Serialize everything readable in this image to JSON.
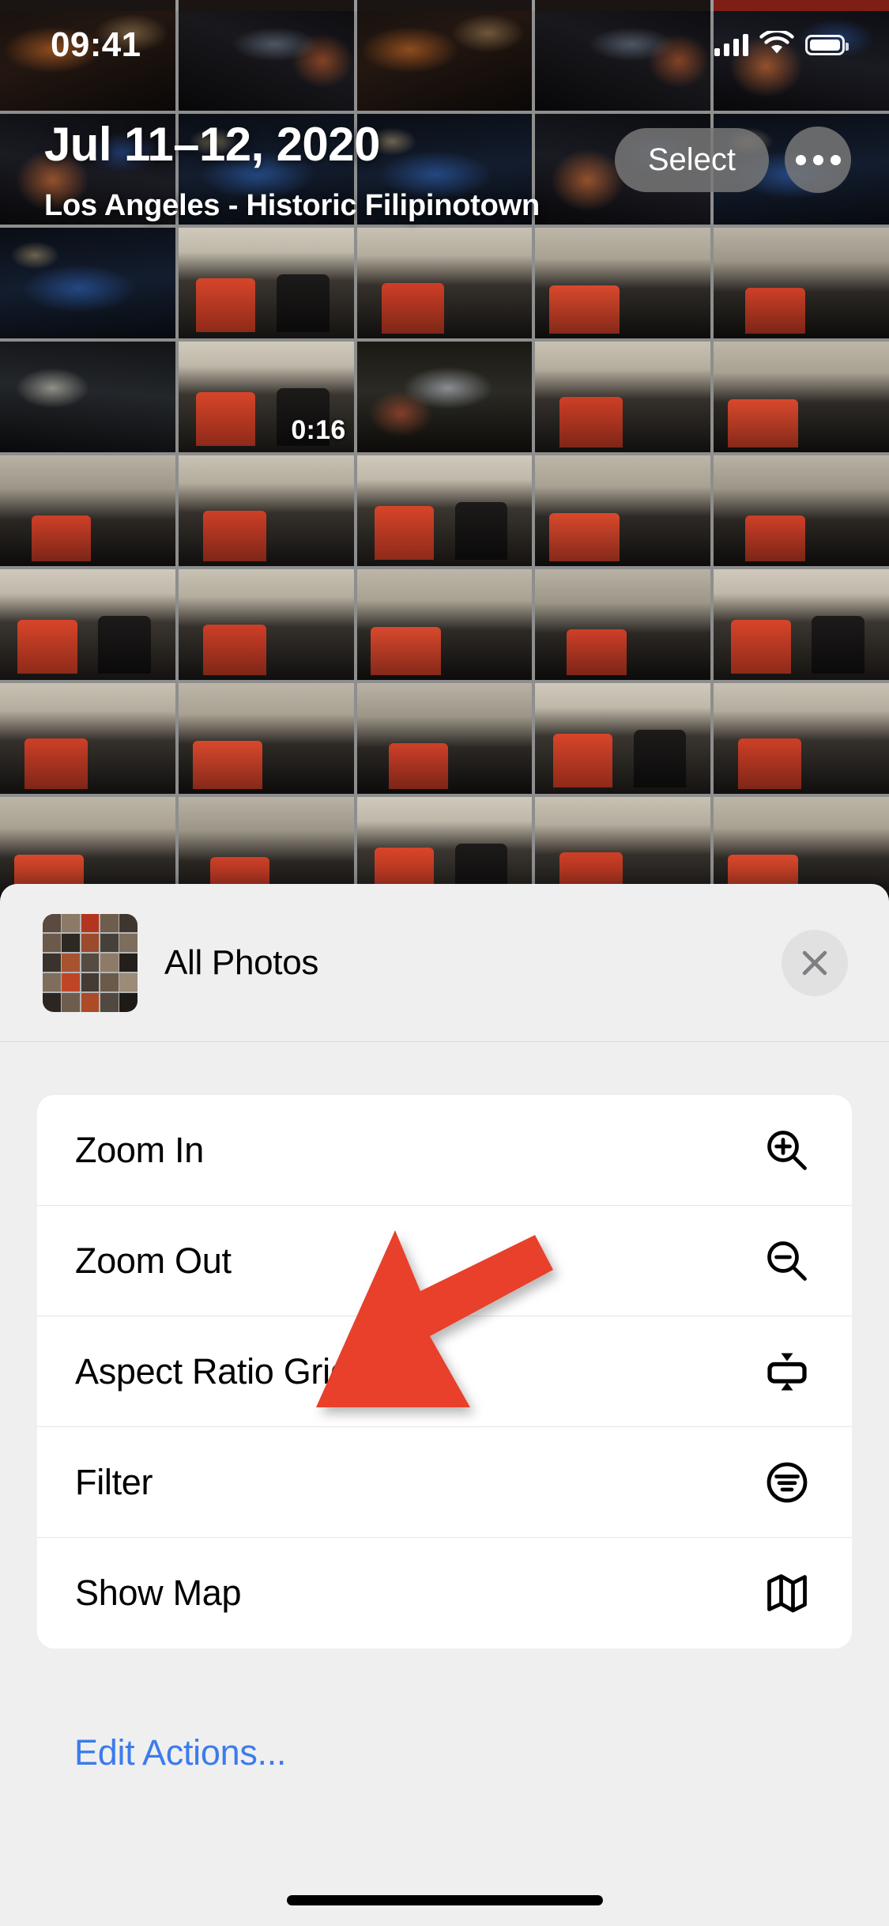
{
  "status_bar": {
    "time": "09:41",
    "signal_icon": "cellular-signal-icon",
    "wifi_icon": "wifi-icon",
    "battery_icon": "battery-full-icon"
  },
  "photos_header": {
    "title": "Jul 11–12, 2020",
    "subtitle": "Los Angeles - Historic Filipinotown",
    "select_label": "Select",
    "more_icon": "ellipsis-icon"
  },
  "photo_grid": {
    "columns": 5,
    "video_badge": "0:16"
  },
  "sheet": {
    "app_name": "All Photos",
    "close_icon": "close-x-icon",
    "menu_items": [
      {
        "label": "Zoom In",
        "icon": "magnifier-plus-icon"
      },
      {
        "label": "Zoom Out",
        "icon": "magnifier-minus-icon"
      },
      {
        "label": "Aspect Ratio Grid",
        "icon": "aspect-ratio-grid-icon"
      },
      {
        "label": "Filter",
        "icon": "filter-circle-icon"
      },
      {
        "label": "Show Map",
        "icon": "map-icon"
      }
    ],
    "edit_actions_label": "Edit Actions..."
  },
  "annotation": {
    "arrow_color": "#e8402a",
    "points_at": "Aspect Ratio Grid"
  },
  "colors": {
    "sheet_background": "#f0efef",
    "card_background": "#ffffff",
    "accent_blue": "#3b7ced",
    "separator": "#e6e6e6",
    "close_button_bg": "#e2e1e1"
  }
}
